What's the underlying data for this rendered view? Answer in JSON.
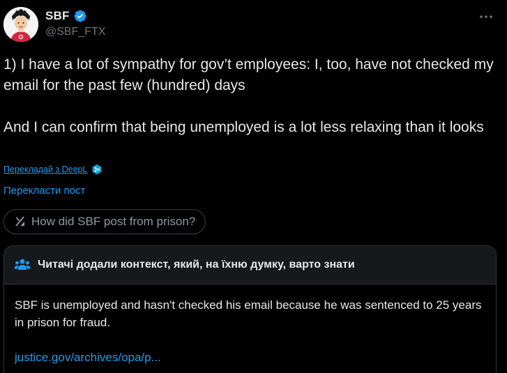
{
  "author": {
    "display_name": "SBF",
    "handle": "@SBF_FTX",
    "verified": true,
    "verified_color": "#1d9bf0",
    "avatar_icon": "avatar-cartoon-icon"
  },
  "tweet": {
    "paragraph_1": "1) I have a lot of sympathy for gov’t employees: I, too, have not checked my email for the past few (hundred) days",
    "paragraph_2": "And I can confirm that being unemployed is a lot less relaxing than it looks"
  },
  "translate": {
    "deepl_label": "Перекладай з DeepL",
    "translate_post_label": "Перекласти пост"
  },
  "grok": {
    "question": "How did SBF post from prison?"
  },
  "community_note": {
    "title": "Читачі додали контекст, який, на їхню думку, варто знати",
    "body": "SBF is unemployed and hasn't checked his email because he was sentenced to 25 years in prison for fraud.",
    "link": "justice.gov/archives/opa/p..."
  },
  "colors": {
    "background": "#000000",
    "text": "#e7e9ea",
    "secondary": "#71767b",
    "link": "#1d9bf0",
    "note_header_bg": "#16181c",
    "border": "#2f3336"
  }
}
